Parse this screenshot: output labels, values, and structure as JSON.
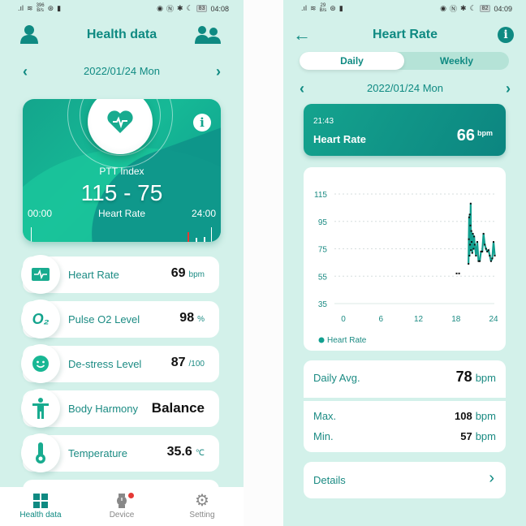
{
  "left": {
    "status": {
      "net_speed": "396",
      "net_unit": "B/s",
      "battery": "83",
      "time": "04:08"
    },
    "header": {
      "title": "Health data",
      "profile_icon": "person-icon",
      "family_icon": "group-icon"
    },
    "date": {
      "label": "2022/01/24 Mon",
      "prev": "‹",
      "next": "›"
    },
    "ptt_card": {
      "label": "PTT Index",
      "value": "115 - 75",
      "sub_label": "Heart Rate",
      "time_start": "00:00",
      "time_end": "24:00",
      "info": "i",
      "accent_alert": "#e53935"
    },
    "metrics": [
      {
        "icon": "ecg-icon",
        "name": "Heart Rate",
        "value": "69",
        "unit": "bpm"
      },
      {
        "icon": "o2-icon",
        "icon_text": "O₂",
        "name": "Pulse O2 Level",
        "value": "98",
        "unit": "%"
      },
      {
        "icon": "smiley-icon",
        "name": "De-stress Level",
        "value": "87",
        "unit": "/100"
      },
      {
        "icon": "body-icon",
        "name": "Body Harmony",
        "value": "Balance",
        "unit": ""
      },
      {
        "icon": "thermometer-icon",
        "name": "Temperature",
        "value": "35.6",
        "unit": "℃"
      }
    ],
    "tabs": [
      {
        "icon": "grid-icon",
        "label": "Health data",
        "active": true
      },
      {
        "icon": "watch-icon",
        "label": "Device",
        "badge": true
      },
      {
        "icon": "gear-icon",
        "label": "Setting"
      }
    ]
  },
  "right": {
    "status": {
      "net_speed": "29",
      "net_unit": "B/s",
      "battery": "82",
      "time": "04:09"
    },
    "header": {
      "title": "Heart Rate",
      "back": "←",
      "info": "i"
    },
    "segment": {
      "options": [
        "Daily",
        "Weekly"
      ],
      "selected": "Daily"
    },
    "date": {
      "label": "2022/01/24 Mon",
      "prev": "‹",
      "next": "›"
    },
    "current": {
      "time": "21:43",
      "label": "Heart Rate",
      "value": "66",
      "unit": "bpm"
    },
    "stats": {
      "avg_label": "Daily Avg.",
      "avg_value": "78",
      "avg_unit": "bpm",
      "max_label": "Max.",
      "max_value": "108",
      "max_unit": "bpm",
      "min_label": "Min.",
      "min_value": "57",
      "min_unit": "bpm"
    },
    "details": {
      "label": "Details",
      "chevron": "›"
    }
  },
  "chart_data": {
    "type": "line",
    "title": "",
    "xlabel": "",
    "ylabel": "",
    "xlim": [
      0,
      24
    ],
    "ylim": [
      35,
      115
    ],
    "x_ticks": [
      "0",
      "6",
      "12",
      "18",
      "24"
    ],
    "y_ticks": [
      "115",
      "95",
      "75",
      "55",
      "35"
    ],
    "grid": true,
    "legend": "bottom-left",
    "series": [
      {
        "name": "Heart Rate",
        "color": "#12a090",
        "isolated_points": [
          [
            18.1,
            57
          ],
          [
            18.5,
            57
          ]
        ],
        "points": [
          [
            20.0,
            64
          ],
          [
            20.05,
            82
          ],
          [
            20.1,
            98
          ],
          [
            20.15,
            70
          ],
          [
            20.2,
            100
          ],
          [
            20.25,
            78
          ],
          [
            20.3,
            92
          ],
          [
            20.35,
            108
          ],
          [
            20.4,
            74
          ],
          [
            20.45,
            88
          ],
          [
            20.5,
            80
          ],
          [
            20.6,
            72
          ],
          [
            20.7,
            86
          ],
          [
            20.8,
            75
          ],
          [
            20.9,
            84
          ],
          [
            21.0,
            78
          ],
          [
            21.2,
            70
          ],
          [
            21.4,
            80
          ],
          [
            21.6,
            66
          ],
          [
            21.8,
            66
          ],
          [
            22.0,
            73
          ],
          [
            22.2,
            73
          ],
          [
            22.4,
            86
          ],
          [
            22.6,
            78
          ],
          [
            22.8,
            75
          ],
          [
            23.0,
            73
          ],
          [
            23.2,
            74
          ],
          [
            23.4,
            70
          ],
          [
            23.6,
            66
          ],
          [
            23.8,
            68
          ],
          [
            24.0,
            80
          ],
          [
            24.2,
            70
          ]
        ]
      }
    ]
  }
}
